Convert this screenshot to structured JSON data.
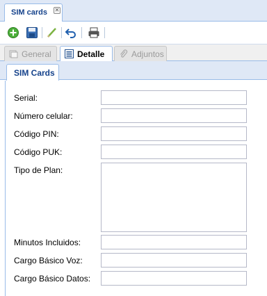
{
  "window": {
    "tab_title": "SIM cards"
  },
  "toolbar": {
    "buttons": [
      "add-icon",
      "save-icon",
      "edit-icon",
      "undo-icon",
      "print-icon"
    ]
  },
  "tabs": [
    {
      "label": "General",
      "state": "disabled"
    },
    {
      "label": "Detalle",
      "state": "active"
    },
    {
      "label": "Adjuntos",
      "state": "disabled"
    }
  ],
  "panel": {
    "tab_label": "SIM Cards"
  },
  "form": {
    "fields": [
      {
        "label": "Serial:",
        "value": ""
      },
      {
        "label": "Número celular:",
        "value": ""
      },
      {
        "label": "Código PIN:",
        "value": ""
      },
      {
        "label": "Código PUK:",
        "value": ""
      },
      {
        "label": "Tipo de Plan:",
        "value": ""
      },
      {
        "label": "Minutos Incluidos:",
        "value": ""
      },
      {
        "label": "Cargo Básico Voz:",
        "value": ""
      },
      {
        "label": "Cargo Básico Datos:",
        "value": ""
      }
    ]
  },
  "colors": {
    "accent": "#15428b",
    "border": "#99bbe8",
    "header_bg": "#dfe8f6"
  }
}
